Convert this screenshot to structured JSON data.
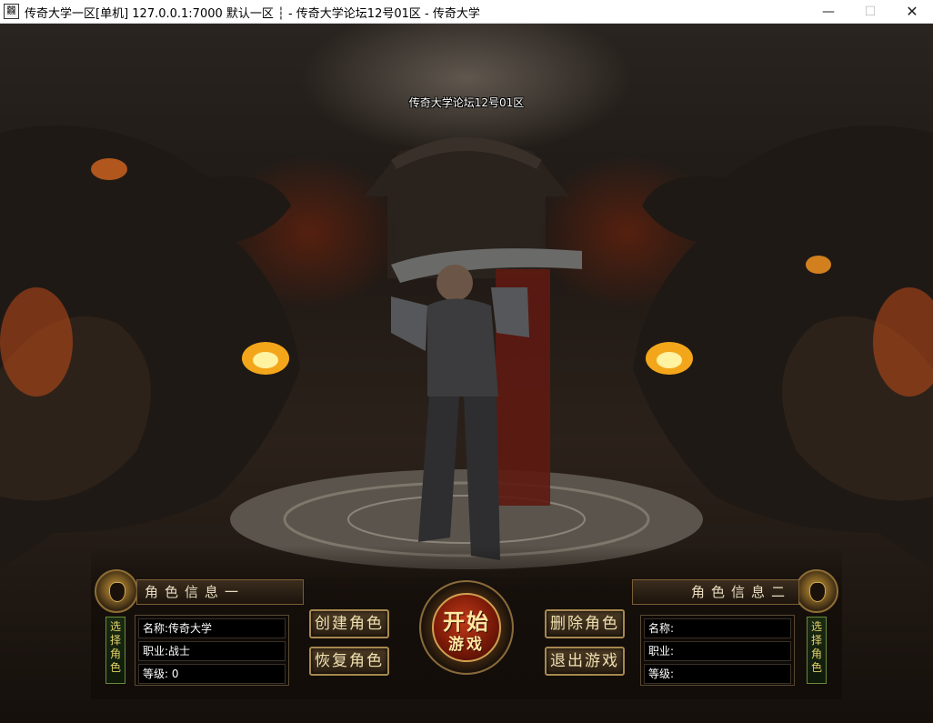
{
  "window": {
    "title": "传奇大学一区[单机] 127.0.0.1:7000  默认一区 ┆ - 传奇大学论坛12号01区 - 传奇大学",
    "icon_glyph": "龖",
    "minimize_glyph": "—",
    "maximize_glyph": "☐",
    "close_glyph": "✕"
  },
  "scene": {
    "server_name": "传奇大学论坛12号01区"
  },
  "character_one": {
    "header": "角色信息一",
    "select_label": "选择角色",
    "name": "名称:传奇大学",
    "job": "职业:战士",
    "level": "等级: 0"
  },
  "character_two": {
    "header": "角色信息二",
    "select_label": "选择角色",
    "name": "名称:",
    "job": "职业:",
    "level": "等级:"
  },
  "buttons": {
    "create": "创建角色",
    "restore": "恢复角色",
    "delete": "删除角色",
    "exit": "退出游戏",
    "start_line1": "开始",
    "start_line2": "游戏"
  },
  "colors": {
    "gold_text": "#f0e0b0",
    "start_red": "#c23a18",
    "panel_border": "#a7884f"
  }
}
